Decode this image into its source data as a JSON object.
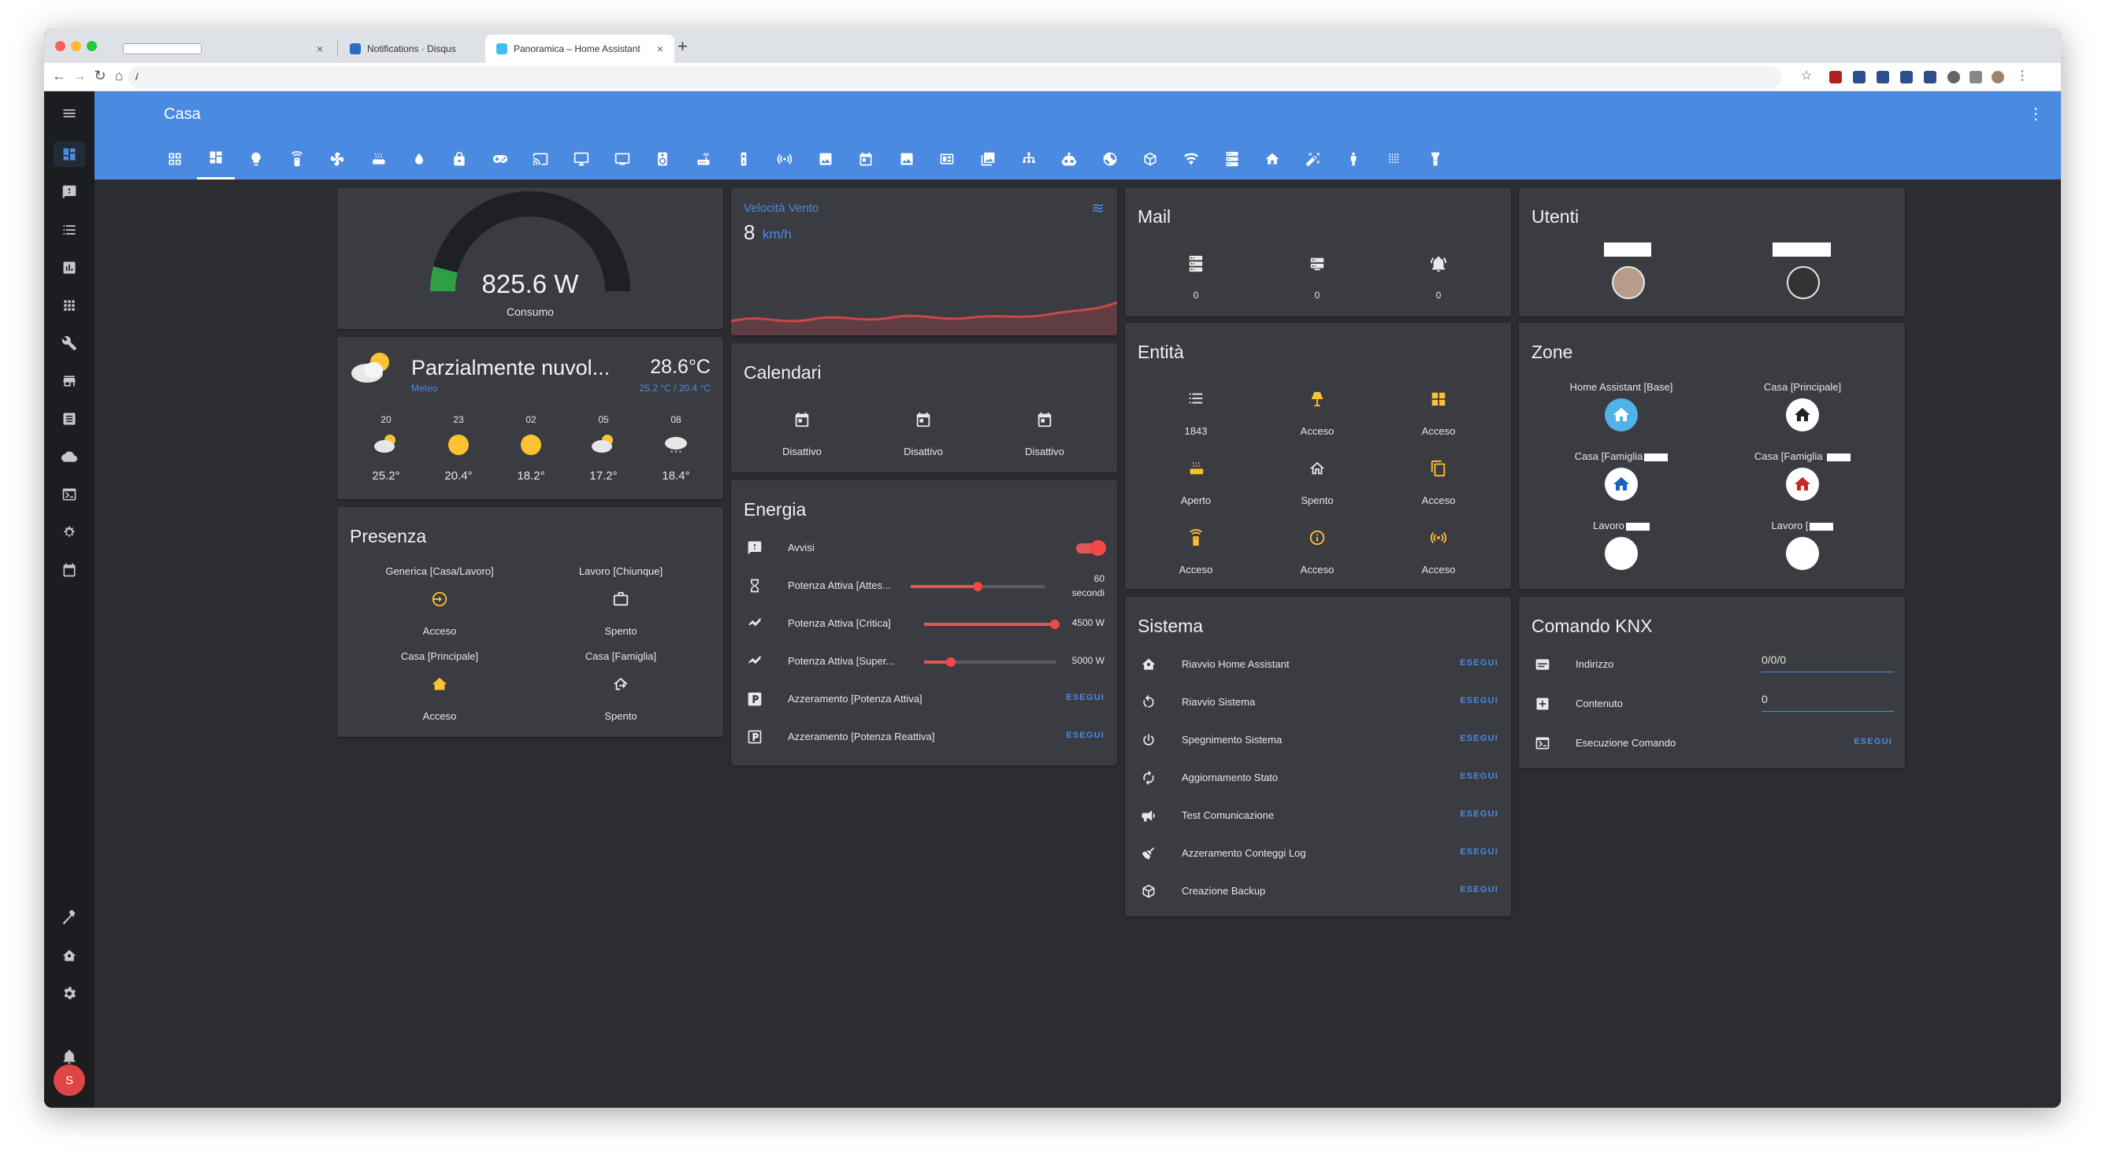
{
  "browser": {
    "tabs": [
      {
        "title": "",
        "active": false
      },
      {
        "title": "Notifications · Disqus",
        "active": false
      },
      {
        "title": "Panoramica – Home Assistant",
        "active": true
      }
    ],
    "new_tab": "+",
    "address": "/"
  },
  "app": {
    "title": "Casa",
    "user_initial": "S"
  },
  "sidebar_icons": [
    "dashboard-icon",
    "message-icon",
    "list-icon",
    "chart-icon",
    "grid-icon",
    "wrench-icon",
    "store-icon",
    "notes-icon",
    "cloud-icon",
    "terminal-icon",
    "network-icon",
    "calendar-icon",
    "hammer-icon",
    "home-gear-icon",
    "settings-icon",
    "bell-icon"
  ],
  "view_icons": [
    "view-grid-outline-icon",
    "dashboard-icon",
    "lightbulb-icon",
    "remote-icon",
    "fan-ac-icon",
    "radiator-icon",
    "water-icon",
    "lock-icon",
    "gamepad-icon",
    "cast-icon",
    "monitor-icon",
    "tv-icon",
    "speaker-icon",
    "router-icon",
    "remote-2-icon",
    "signal-icon",
    "satellite-icon",
    "calendar-icon",
    "image-icon",
    "panel-icon",
    "gallery-icon",
    "network-icon",
    "robot-icon",
    "weather-icon",
    "cube-icon",
    "wifi-icon",
    "server-icon",
    "home-icon",
    "magic-icon",
    "person-icon",
    "dots-icon",
    "flashlight-icon"
  ],
  "power": {
    "value": "825.6 W",
    "name": "Consumo",
    "fraction": 0.08
  },
  "wind": {
    "title": "Velocità Vento",
    "value": "8",
    "unit": "km/h"
  },
  "mail": {
    "title": "Mail",
    "items": [
      {
        "icon": "server-icon",
        "value": "0"
      },
      {
        "icon": "server-minus-icon",
        "value": "0"
      },
      {
        "icon": "bell-ring-icon",
        "value": "0"
      }
    ]
  },
  "users": {
    "title": "Utenti"
  },
  "weather": {
    "condition": "Parzialmente nuvol...",
    "temperature": "28.6°C",
    "name": "Meteo",
    "range": "25.2 °C / 20.4 °C",
    "forecast": [
      {
        "hour": "20",
        "temp": "25.2°",
        "icon": "partly-cloudy-night-icon"
      },
      {
        "hour": "23",
        "temp": "20.4°",
        "icon": "sunny-icon"
      },
      {
        "hour": "02",
        "temp": "18.2°",
        "icon": "sunny-icon"
      },
      {
        "hour": "05",
        "temp": "17.2°",
        "icon": "partly-cloudy-icon"
      },
      {
        "hour": "08",
        "temp": "18.4°",
        "icon": "snowy-cloud-icon"
      }
    ]
  },
  "calendars": {
    "title": "Calendari",
    "items": [
      {
        "state": "Disattivo"
      },
      {
        "state": "Disattivo"
      },
      {
        "state": "Disattivo"
      }
    ]
  },
  "entities": {
    "title": "Entità",
    "items": [
      {
        "icon": "format-list-icon",
        "state": "1843",
        "active": false
      },
      {
        "icon": "lamp-icon",
        "state": "Acceso",
        "active": true
      },
      {
        "icon": "panels-icon",
        "state": "Acceso",
        "active": true
      },
      {
        "icon": "radiator-icon",
        "state": "Aperto",
        "active": true
      },
      {
        "icon": "home-outline-icon",
        "state": "Spento",
        "active": false
      },
      {
        "icon": "copy-icon",
        "state": "Acceso",
        "active": true
      },
      {
        "icon": "remote-icon",
        "state": "Acceso",
        "active": true
      },
      {
        "icon": "info-icon",
        "state": "Acceso",
        "active": true
      },
      {
        "icon": "radio-tower-icon",
        "state": "Acceso",
        "active": true
      }
    ]
  },
  "zones": {
    "title": "Zone",
    "items": [
      {
        "name": "Home Assistant [Base]",
        "color": "#4fb3ea"
      },
      {
        "name": "Casa [Principale]",
        "color": "#ffffff"
      },
      {
        "name": "Casa [Famiglia",
        "color": "#ffffff"
      },
      {
        "name": "Casa [Famiglia ",
        "color": "#ffffff"
      },
      {
        "name": "Lavoro",
        "color": "#ffffff"
      },
      {
        "name": "Lavoro [",
        "color": "#ffffff"
      }
    ]
  },
  "presence": {
    "title": "Presenza",
    "items": [
      {
        "name": "Generica [Casa/Lavoro]",
        "state": "Acceso",
        "active": true,
        "icon": "login-icon"
      },
      {
        "name": "Lavoro [Chiunque]",
        "state": "Spento",
        "active": false,
        "icon": "briefcase-icon"
      },
      {
        "name": "Casa [Principale]",
        "state": "Acceso",
        "active": true,
        "icon": "home-import-icon"
      },
      {
        "name": "Casa [Famiglia]",
        "state": "Spento",
        "active": false,
        "icon": "home-export-icon"
      }
    ]
  },
  "energy": {
    "title": "Energia",
    "rows": [
      {
        "icon": "alert-box-icon",
        "label": "Avvisi",
        "type": "toggle",
        "on": true
      },
      {
        "icon": "hourglass-icon",
        "label": "Potenza Attiva [Attes...",
        "type": "slider",
        "value": "60",
        "unit": "secondi",
        "fraction": 0.5
      },
      {
        "icon": "chart-area-icon",
        "label": "Potenza Attiva [Critica]",
        "type": "slider",
        "value": "4500 W",
        "fraction": 0.99
      },
      {
        "icon": "chart-area-icon",
        "label": "Potenza Attiva [Super...",
        "type": "slider",
        "value": "5000 W",
        "fraction": 0.2
      },
      {
        "icon": "parking-box-icon",
        "label": "Azzeramento [Potenza Attiva]",
        "type": "button",
        "action": "ESEGUI"
      },
      {
        "icon": "parking-outline-icon",
        "label": "Azzeramento [Potenza Reattiva]",
        "type": "button",
        "action": "ESEGUI"
      }
    ]
  },
  "system": {
    "title": "Sistema",
    "rows": [
      {
        "icon": "home-gear-icon",
        "label": "Riavvio Home Assistant",
        "action": "ESEGUI"
      },
      {
        "icon": "restart-icon",
        "label": "Riavvio Sistema",
        "action": "ESEGUI"
      },
      {
        "icon": "power-icon",
        "label": "Spegnimento Sistema",
        "action": "ESEGUI"
      },
      {
        "icon": "refresh-icon",
        "label": "Aggiornamento Stato",
        "action": "ESEGUI"
      },
      {
        "icon": "bullhorn-icon",
        "label": "Test Comunicazione",
        "action": "ESEGUI"
      },
      {
        "icon": "broom-icon",
        "label": "Azzeramento Conteggi Log",
        "action": "ESEGUI"
      },
      {
        "icon": "package-icon",
        "label": "Creazione Backup",
        "action": "ESEGUI"
      }
    ]
  },
  "knx": {
    "title": "Comando KNX",
    "rows": [
      {
        "icon": "card-text-icon",
        "label": "Indirizzo",
        "value": "0/0/0"
      },
      {
        "icon": "plus-box-icon",
        "label": "Contenuto",
        "value": "0"
      },
      {
        "icon": "console-icon",
        "label": "Esecuzione Comando",
        "action": "ESEGUI"
      }
    ]
  },
  "colors": {
    "primary": "#4a8ae0",
    "active_icon": "#fcc233",
    "accent": "#f34646",
    "gauge_fill": "#2ea043"
  }
}
